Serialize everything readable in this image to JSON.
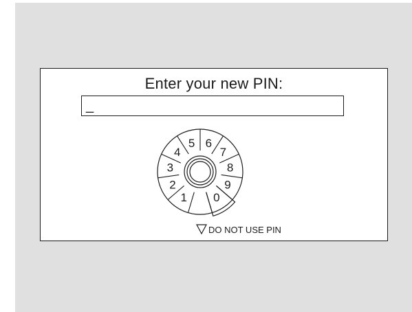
{
  "dialog": {
    "title": "Enter your new PIN:",
    "pin_value": "_"
  },
  "dial": {
    "digits": [
      "0",
      "1",
      "2",
      "3",
      "4",
      "5",
      "6",
      "7",
      "8",
      "9"
    ],
    "selected_digit": "0",
    "footer_icon": "triangle-down-icon",
    "footer_label": "DO NOT USE PIN"
  }
}
